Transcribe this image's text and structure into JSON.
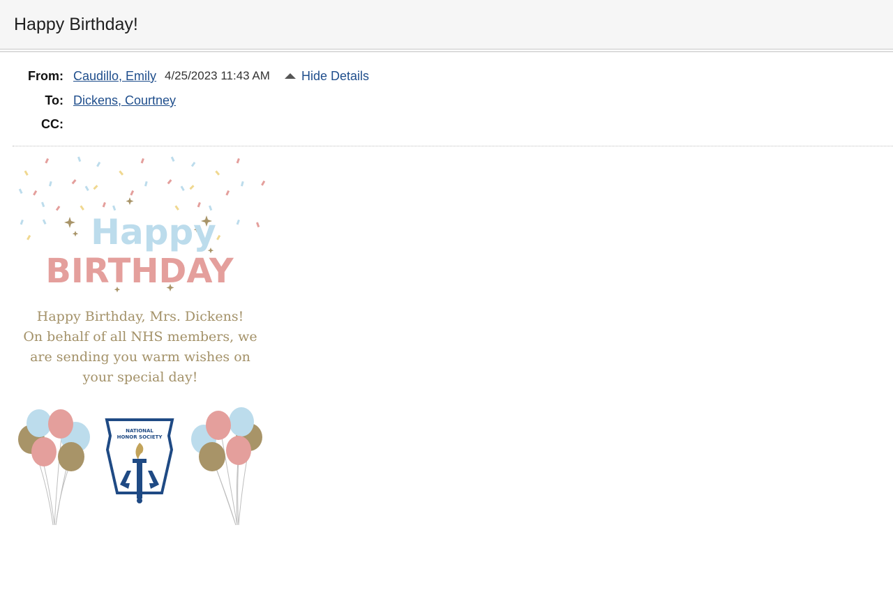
{
  "email": {
    "subject": "Happy Birthday!",
    "from_label": "From:",
    "from_name": "Caudillo, Emily",
    "sent": "4/25/2023 11:43 AM",
    "hide_details": "Hide Details",
    "to_label": "To:",
    "to_name": "Dickens, Courtney",
    "cc_label": "CC:"
  },
  "card": {
    "happy_word": "Happy",
    "birthday_word": "BIRTHDAY",
    "message_lines": [
      "Happy Birthday, Mrs. Dickens!",
      "On behalf of all NHS members, we",
      "are sending you warm wishes on",
      "your special day!"
    ],
    "logo_line1": "NATIONAL",
    "logo_line2": "HONOR SOCIETY",
    "colors": {
      "blue": "#bcdcec",
      "pink": "#e49f9c",
      "gold": "#a89468",
      "navy": "#1f4a84"
    }
  }
}
